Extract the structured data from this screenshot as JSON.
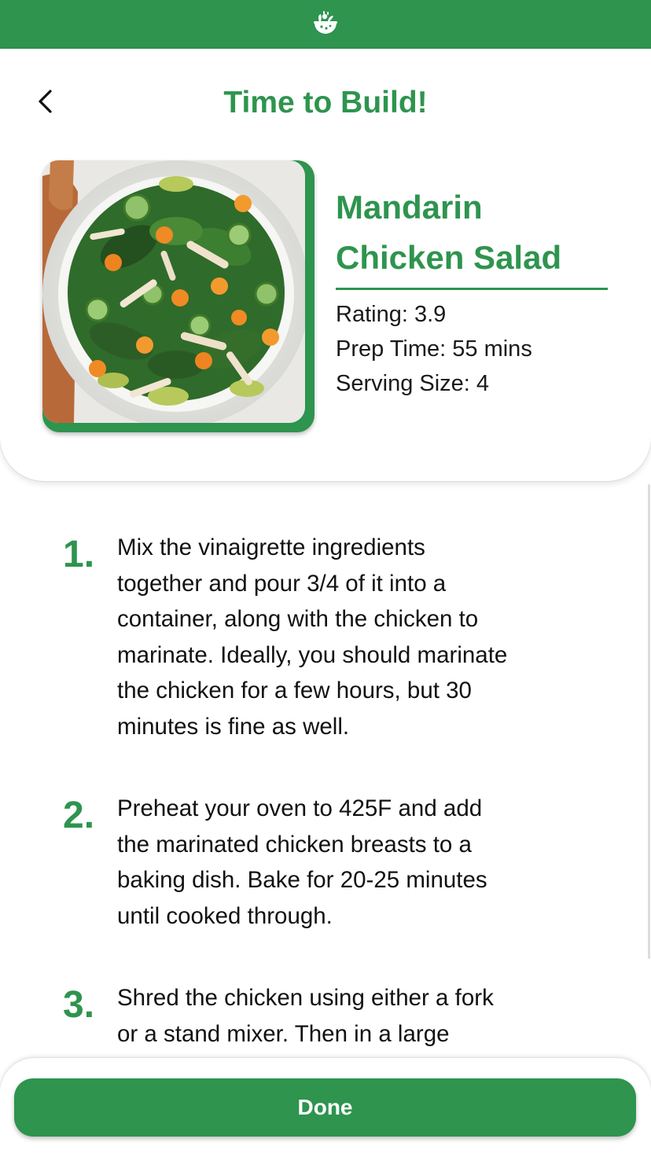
{
  "app": {
    "logo_icon": "salad-bowl-icon",
    "brand_color": "#2e944e"
  },
  "header": {
    "back_icon": "chevron-left-icon",
    "title": "Time to Build!"
  },
  "recipe": {
    "name_line1": "Mandarin",
    "name_line2": "Chicken Salad",
    "rating": "Rating: 3.9",
    "prep_time": "Prep Time: 55 mins",
    "serving_size": "Serving Size: 4",
    "image_icon": "salad-photo"
  },
  "steps": [
    {
      "number": "1.",
      "lines": [
        "Mix the vinaigrette ingredients",
        "together and pour 3/4 of it into a",
        "container, along with the chicken to",
        "marinate. Ideally, you should marinate",
        "the chicken for a few hours, but 30",
        "minutes is fine as well."
      ]
    },
    {
      "number": "2.",
      "lines": [
        "Preheat your oven to 425F and add",
        "the marinated chicken breasts to a",
        "baking dish. Bake for 20-25 minutes",
        "until cooked through."
      ]
    },
    {
      "number": "3.",
      "lines": [
        "Shred the chicken using either a fork",
        "or a stand mixer. Then in a large"
      ]
    }
  ],
  "footer": {
    "done_label": "Done"
  }
}
